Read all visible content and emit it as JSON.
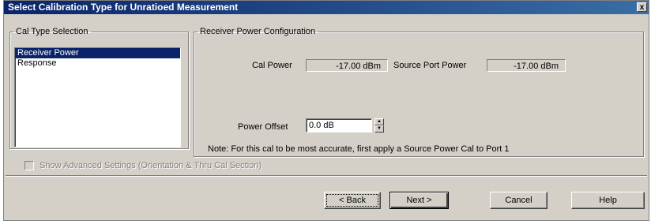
{
  "window": {
    "title": "Select Calibration Type for Unratioed Measurement",
    "close_label": "x"
  },
  "cal_type": {
    "legend": "Cal Type Selection",
    "items": [
      {
        "label": "Receiver Power",
        "selected": true
      },
      {
        "label": "Response",
        "selected": false
      }
    ]
  },
  "receiver": {
    "legend": "Receiver Power Configuration",
    "cal_power_label": "Cal Power",
    "cal_power_value": "-17.00 dBm",
    "source_port_power_label": "Source Port Power",
    "source_port_power_value": "-17.00 dBm",
    "power_offset_label": "Power Offset",
    "power_offset_value": "0.0 dB",
    "note": "Note: For this cal to be most accurate, first apply a Source Power Cal to Port 1"
  },
  "advanced": {
    "label": "Show Advanced Settings (Orientation & Thru Cal Section)",
    "checked": false,
    "enabled": false
  },
  "buttons": {
    "back": "< Back",
    "next": "Next >",
    "cancel": "Cancel",
    "help": "Help"
  }
}
